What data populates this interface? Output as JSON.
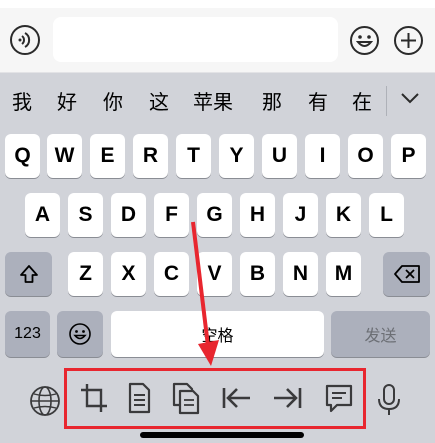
{
  "candidates": [
    "我",
    "好",
    "你",
    "这",
    "苹果",
    "那",
    "有",
    "在"
  ],
  "rows": {
    "row1": [
      "Q",
      "W",
      "E",
      "R",
      "T",
      "Y",
      "U",
      "I",
      "O",
      "P"
    ],
    "row2": [
      "A",
      "S",
      "D",
      "F",
      "G",
      "H",
      "J",
      "K",
      "L"
    ],
    "row3": [
      "Z",
      "X",
      "C",
      "V",
      "B",
      "N",
      "M"
    ]
  },
  "bottom_row": {
    "numbers_label": "123",
    "space_label": "空格",
    "send_label": "发送"
  },
  "toolbar_icons": [
    "crop-icon",
    "document-icon",
    "copy-icon",
    "move-to-start-icon",
    "move-to-end-icon",
    "message-icon"
  ],
  "colors": {
    "keyboard_bg": "#d1d3d9",
    "key": "#ffffff",
    "function_key": "#acb0bc",
    "annotation": "#e8262f"
  }
}
